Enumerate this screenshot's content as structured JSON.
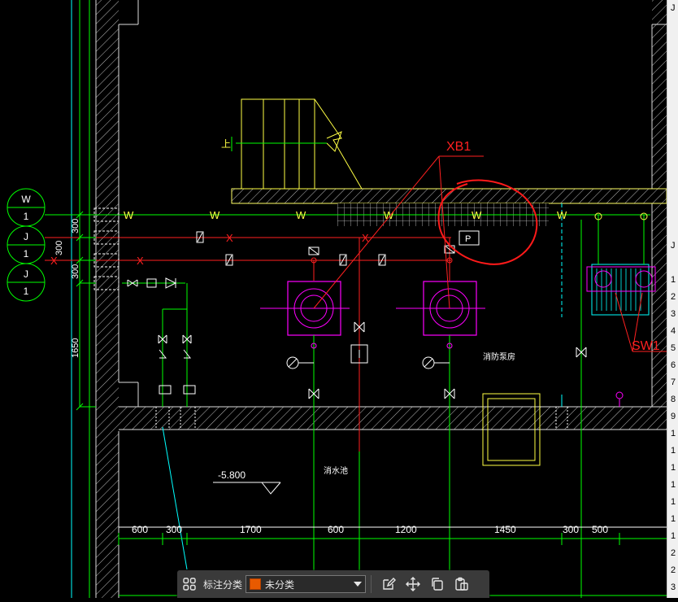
{
  "cad": {
    "bubbles": [
      {
        "top": "W",
        "bottom": "1"
      },
      {
        "top": "J",
        "bottom": "1"
      },
      {
        "top": "J",
        "bottom": "1"
      }
    ],
    "pipe_w": "W",
    "pipe_x": "X",
    "stair_up": "上",
    "tag_xb1": "XB1",
    "tag_sw1": "SW1",
    "p_label": "P",
    "pump_room": "消防泵房",
    "pool_label": "消水池",
    "elevation": "-5.800",
    "vert_dims": [
      "300",
      "300",
      "300",
      "1650"
    ],
    "horiz_dims": [
      "600",
      "300",
      "1700",
      "600",
      "1200",
      "1450",
      "300",
      "500"
    ]
  },
  "right_panel": {
    "header": "J",
    "row_numbers": [
      "1",
      "2",
      "3",
      "4",
      "5",
      "6",
      "7",
      "8",
      "9",
      "1",
      "1",
      "1",
      "1",
      "1",
      "1",
      "1",
      "2",
      "2",
      "3"
    ]
  },
  "toolbar": {
    "category_label": "标注分类",
    "category_value": "未分类"
  }
}
